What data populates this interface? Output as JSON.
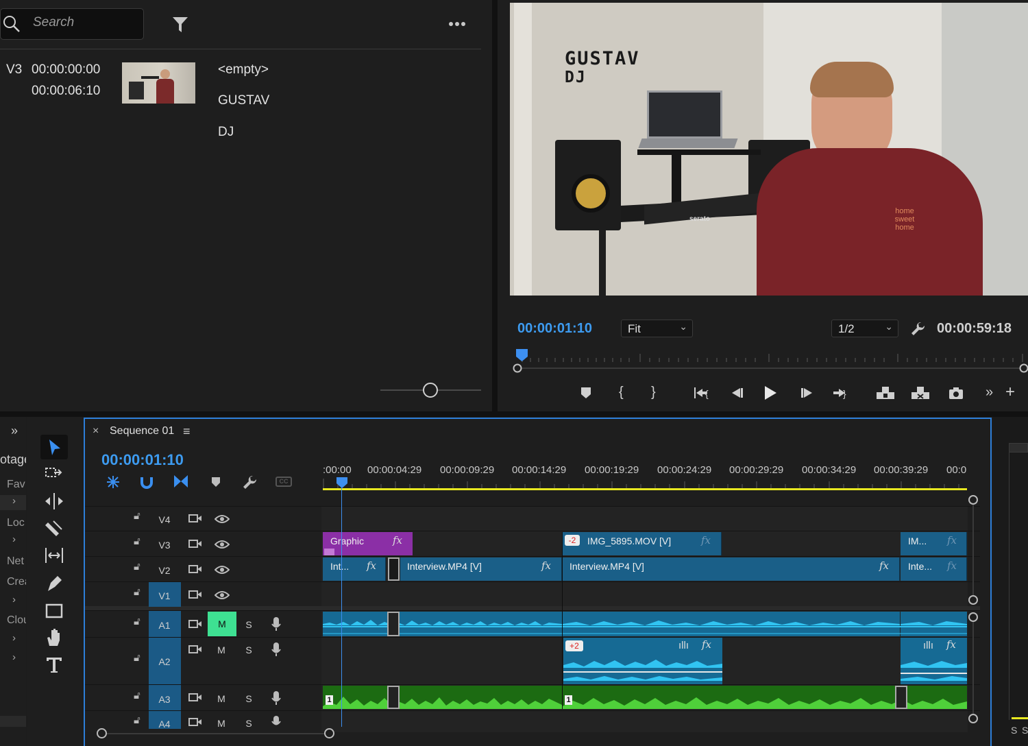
{
  "source_panel": {
    "search_placeholder": "Search",
    "clip": {
      "track": "V3",
      "in_time": "00:00:00:00",
      "duration": "00:00:06:10",
      "text_layers": [
        "<empty>",
        "GUSTAV",
        "DJ"
      ]
    }
  },
  "program_monitor": {
    "overlay_title": "GUSTAV",
    "overlay_subtitle": "DJ",
    "current_time": "00:00:01:10",
    "fit": "Fit",
    "resolution": "1/2",
    "duration": "00:00:59:18",
    "shirt_text": "home sweet home",
    "controller_brand": "serato"
  },
  "project_strip": {
    "items": [
      "otage",
      "Fav",
      "Loc",
      "Net",
      "Crea",
      "Clou"
    ]
  },
  "timeline": {
    "sequence_name": "Sequence 01",
    "current_time": "00:00:01:10",
    "ruler_labels": [
      ":00:00",
      "00:00:04:29",
      "00:00:09:29",
      "00:00:14:29",
      "00:00:19:29",
      "00:00:24:29",
      "00:00:29:29",
      "00:00:34:29",
      "00:00:39:29",
      "00:0"
    ],
    "video_tracks": [
      "V4",
      "V3",
      "V2",
      "V1"
    ],
    "audio_tracks": [
      "A1",
      "A2",
      "A3",
      "A4"
    ],
    "mute_label": "M",
    "solo_label": "S",
    "clips": {
      "graphic": "Graphic",
      "img": "IMG_5895.MOV [V]",
      "img_badge": "-2",
      "im_short": "IM...",
      "int_short": "Int...",
      "interview1": "Interview.MP4 [V]",
      "interview2": "Interview.MP4 [V]",
      "inte_short": "Inte...",
      "a2_badge": "+2",
      "a3_marker1": "1",
      "a3_marker2": "1"
    }
  },
  "colors": {
    "accent_blue": "#3d9bf0",
    "video_clip": "#1a5f88",
    "graphic_clip": "#8b2fa6",
    "audio_clip": "#166a94",
    "music_clip": "#1c6b12",
    "mute_active": "#35d48a",
    "work_area": "#e8e820"
  },
  "right_strip_labels": [
    "S",
    "S"
  ]
}
